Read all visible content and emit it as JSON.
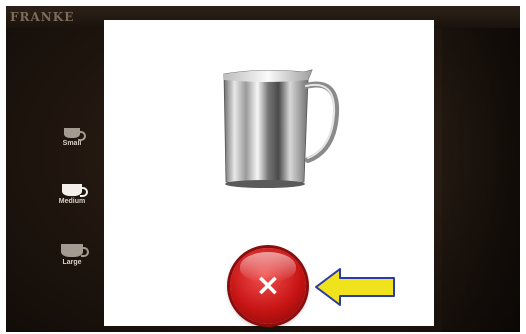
{
  "app": {
    "brand": "FRANKE"
  },
  "sizes": [
    {
      "label": "Small",
      "icon": "cup-small-icon"
    },
    {
      "label": "Medium",
      "icon": "cup-medium-icon"
    },
    {
      "label": "Large",
      "icon": "cup-large-icon"
    }
  ],
  "dialog": {
    "image": "milk-pitcher-icon",
    "close_icon": "close-icon",
    "close_label": "×"
  },
  "annotation": {
    "icon": "arrow-left-icon",
    "color": "#f0e21c"
  },
  "colors": {
    "accent": "#c81414",
    "dialog_background": "#ffffff",
    "screen_background": "#20160f"
  }
}
